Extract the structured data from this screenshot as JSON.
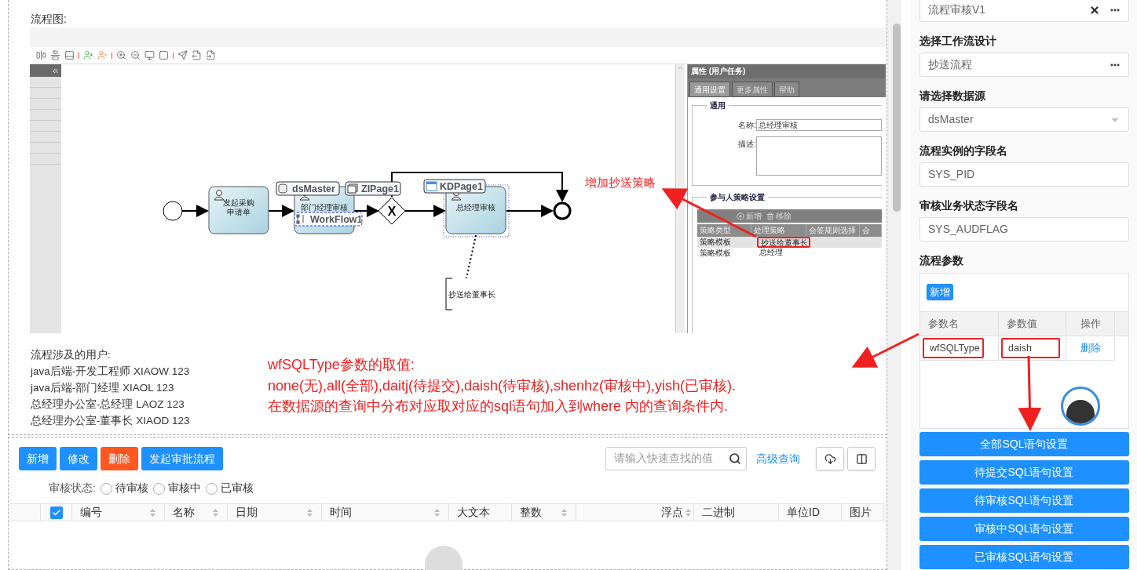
{
  "flow_panel": {
    "label": "流程图:",
    "diagram": {
      "nodes": [
        {
          "kind": "start"
        },
        {
          "kind": "task",
          "lines": [
            "发起采购",
            "申请单"
          ],
          "selected": false
        },
        {
          "kind": "task",
          "lines": [
            "部门经理审核"
          ],
          "selected": false
        },
        {
          "kind": "gateway",
          "symbol": "X"
        },
        {
          "kind": "task",
          "lines": [
            "总经理审核"
          ],
          "selected": true
        },
        {
          "kind": "end"
        }
      ],
      "badges": [
        {
          "kind": "datasource",
          "text": "dsMaster"
        },
        {
          "kind": "workflow",
          "text": "WorkFlow1"
        },
        {
          "kind": "page",
          "text": "ZIPage1"
        },
        {
          "kind": "page",
          "text": "KDPage1"
        }
      ],
      "note": "抄送给董事长"
    },
    "properties": {
      "title": "属性 (用户任务)",
      "tabs": [
        {
          "label": "通用设置",
          "selected": true
        },
        {
          "label": "更多属性",
          "selected": false
        },
        {
          "label": "帮助",
          "selected": false
        }
      ],
      "general_legend": "通用",
      "name_label": "名称:",
      "name_value": "总经理审核",
      "desc_label": "描述:",
      "strategy_legend": "参与人策略设置",
      "grid_actions": [
        "新增",
        "移除"
      ],
      "columns": [
        "策略类型",
        "处理策略",
        "会签规则选择",
        "会"
      ],
      "rows": [
        {
          "type": "策略模板",
          "strategy": "抄送给董事长",
          "highlighted": true
        },
        {
          "type": "策略模板",
          "strategy": "总经理",
          "highlighted": false
        }
      ]
    }
  },
  "users": {
    "title": "流程涉及的用户:",
    "items": [
      "java后端-开发工程师 XIAOW 123",
      "java后端-部门经理 XIAOL 123",
      "总经理办公室-总经理 LAOZ 123",
      "总经理办公室-董事长 XIAOD 123"
    ]
  },
  "annotations": {
    "strategy_note": "增加抄送策略",
    "param_note": [
      "wfSQLType参数的取值:",
      "none(无),all(全部),daitj(待提交),daish(待审核),shenhz(审核中),yish(已审核).",
      "在数据源的查询中分布对应取对应的sql语句加入到where 内的查询条件内."
    ]
  },
  "list_panel": {
    "buttons": [
      {
        "label": "新增",
        "kind": "primary"
      },
      {
        "label": "修改",
        "kind": "primary"
      },
      {
        "label": "删除",
        "kind": "danger"
      },
      {
        "label": "发起审批流程",
        "kind": "primary"
      }
    ],
    "search": {
      "placeholder": "请输入快速查找的值"
    },
    "advanced_link": "高级查询",
    "status_label": "审核状态:",
    "status_options": [
      {
        "label": "待审核",
        "selected": false
      },
      {
        "label": "审核中",
        "selected": false
      },
      {
        "label": "已审核",
        "selected": false
      }
    ],
    "select_all": {
      "checked": true
    },
    "columns": [
      {
        "label": "编号",
        "sortable": true
      },
      {
        "label": "名称",
        "sortable": true
      },
      {
        "label": "日期",
        "sortable": true
      },
      {
        "label": "时间",
        "sortable": true
      },
      {
        "label": "大文本",
        "sortable": false
      },
      {
        "label": "整数",
        "sortable": true
      },
      {
        "label": "浮点",
        "sortable": true
      },
      {
        "label": "二进制",
        "sortable": false
      },
      {
        "label": "单位ID",
        "sortable": false
      },
      {
        "label": "图片",
        "sortable": false
      }
    ]
  },
  "side_panel": {
    "fields": [
      {
        "kind": "picker",
        "value": "流程审核V1",
        "clearable": true
      },
      {
        "kind": "picker",
        "label": "选择工作流设计",
        "value": "抄送流程",
        "clearable": false
      },
      {
        "kind": "select",
        "label": "请选择数据源",
        "value": "dsMaster"
      },
      {
        "kind": "text",
        "label": "流程实例的字段名",
        "value": "SYS_PID"
      },
      {
        "kind": "text",
        "label": "审核业务状态字段名",
        "value": "SYS_AUDFLAG"
      }
    ],
    "params": {
      "label": "流程参数",
      "add_button": "新增",
      "columns": [
        "参数名",
        "参数值",
        "操作"
      ],
      "rows": [
        {
          "name": "wfSQLType",
          "value": "daish",
          "action": "删除",
          "highlighted": true
        }
      ]
    },
    "sql_buttons": [
      "全部SQL语句设置",
      "待提交SQL语句设置",
      "待审核SQL语句设置",
      "审核中SQL语句设置",
      "已审核SQL语句设置"
    ]
  }
}
